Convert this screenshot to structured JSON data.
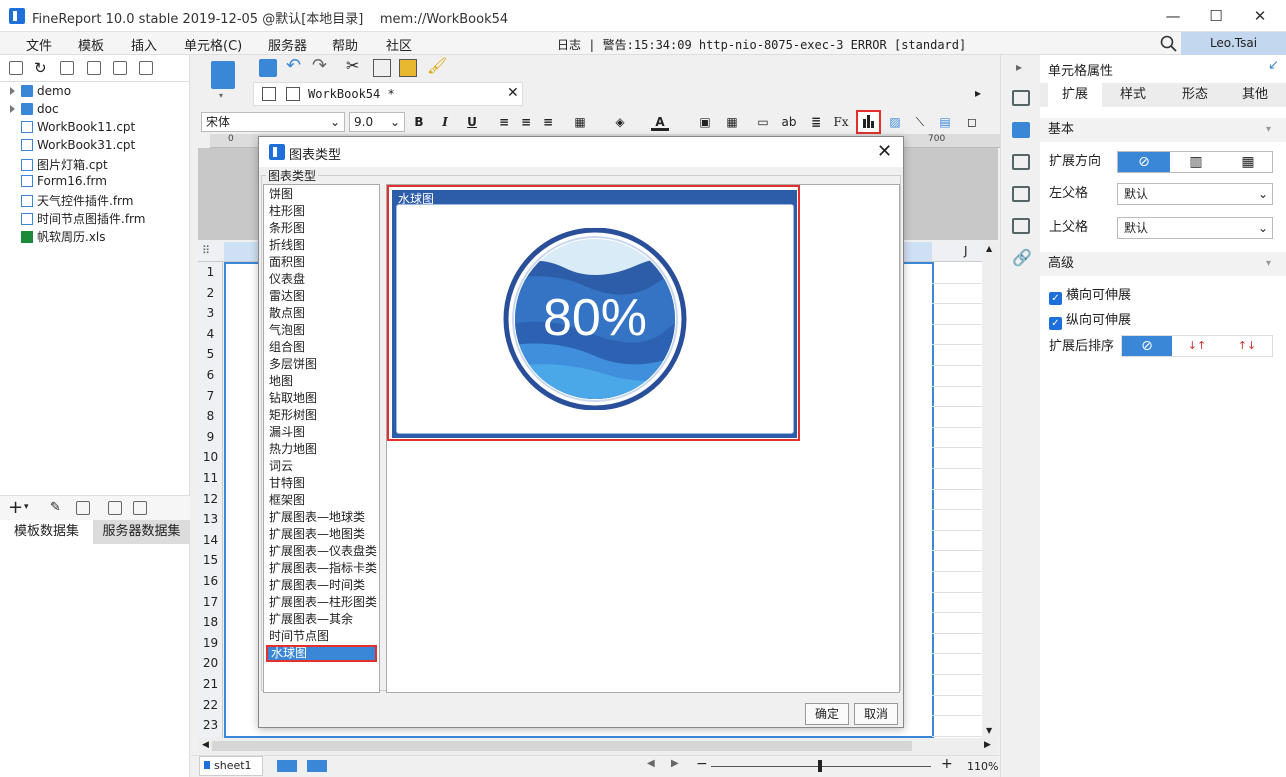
{
  "window": {
    "title": "FineReport 10.0 stable 2019-12-05 @默认[本地目录]    mem://WorkBook54",
    "minimize": "—",
    "maximize": "☐",
    "close": "✕"
  },
  "menubar": {
    "items": [
      "文件",
      "模板",
      "插入",
      "单元格(C)",
      "服务器",
      "帮助",
      "社区"
    ],
    "log": "日志 | 警告:15:34:09 http-nio-8075-exec-3 ERROR [standard]",
    "user": "Leo.Tsai"
  },
  "filetree": {
    "items": [
      {
        "name": "demo",
        "type": "folder"
      },
      {
        "name": "doc",
        "type": "folder"
      },
      {
        "name": "WorkBook11.cpt",
        "type": "file"
      },
      {
        "name": "WorkBook31.cpt",
        "type": "file"
      },
      {
        "name": "图片灯箱.cpt",
        "type": "file"
      },
      {
        "name": "Form16.frm",
        "type": "file"
      },
      {
        "name": "天气控件插件.frm",
        "type": "file"
      },
      {
        "name": "时间节点图插件.frm",
        "type": "file"
      },
      {
        "name": "帆软周历.xls",
        "type": "xls"
      }
    ]
  },
  "datasets": {
    "tabs": [
      "模板数据集",
      "服务器数据集"
    ]
  },
  "editor": {
    "tab_label": "WorkBook54 *",
    "font_name": "宋体",
    "font_size": "9.0",
    "ruler_start": "0",
    "ruler_end": "700",
    "column_J": "J",
    "rows": [
      "1",
      "2",
      "3",
      "4",
      "5",
      "6",
      "7",
      "8",
      "9",
      "10",
      "11",
      "12",
      "13",
      "14",
      "15",
      "16",
      "17",
      "18",
      "19",
      "20",
      "21",
      "22",
      "23"
    ],
    "sheet_tab": "sheet1",
    "zoom": "110%"
  },
  "rightpanel": {
    "title": "单元格属性",
    "tabs": [
      "扩展",
      "样式",
      "形态",
      "其他"
    ],
    "section_basic": "基本",
    "expand_direction": "扩展方向",
    "left_parent": "左父格",
    "left_parent_value": "默认",
    "up_parent": "上父格",
    "up_parent_value": "默认",
    "section_advanced": "高级",
    "horizontal_expand": "横向可伸展",
    "vertical_expand": "纵向可伸展",
    "sort_after_expand": "扩展后排序"
  },
  "dialog": {
    "title": "图表类型",
    "group_label": "图表类型",
    "chart_types": [
      "饼图",
      "柱形图",
      "条形图",
      "折线图",
      "面积图",
      "仪表盘",
      "雷达图",
      "散点图",
      "气泡图",
      "组合图",
      "多层饼图",
      "地图",
      "钻取地图",
      "矩形树图",
      "漏斗图",
      "热力地图",
      "词云",
      "甘特图",
      "框架图",
      "扩展图表—地球类",
      "扩展图表—地图类",
      "扩展图表—仪表盘类",
      "扩展图表—指标卡类",
      "扩展图表—时间类",
      "扩展图表—柱形图类",
      "扩展图表—其余",
      "时间节点图",
      "水球图"
    ],
    "selected_index": 27,
    "preview_title": "水球图",
    "preview_value": "80%",
    "ok": "确定",
    "cancel": "取消"
  },
  "colors": {
    "accent": "#3a87d8",
    "highlight": "#e3302d",
    "water_dark": "#2d5ca8",
    "water_light": "#4aa8e8"
  }
}
